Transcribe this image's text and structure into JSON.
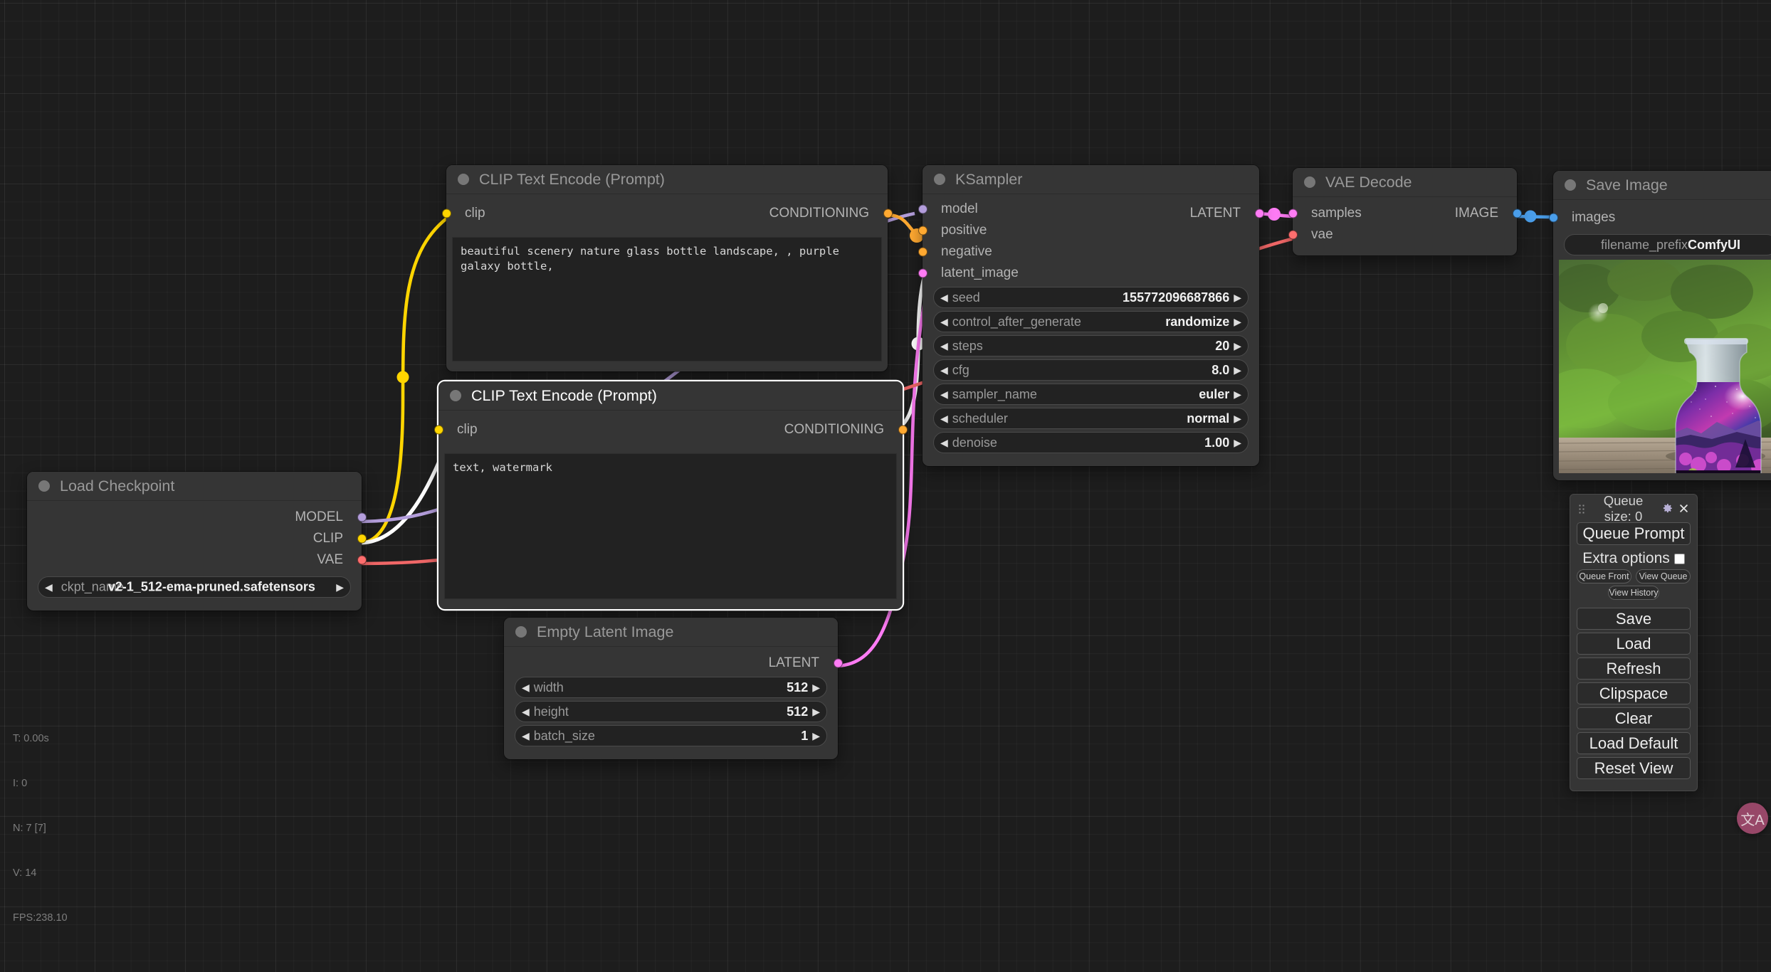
{
  "app": {
    "name": "ComfyUI"
  },
  "colors": {
    "canvas_bg": "#1d1d1d",
    "node_bg": "#353535",
    "node_body": "#353535",
    "widget_bg": "#222222",
    "slot_model": "#b39ddb",
    "slot_clip": "#ffd500",
    "slot_vae": "#ff6e6e",
    "slot_conditioning": "#ffa931",
    "slot_latent": "#ff7cf5",
    "slot_image": "#64b5f6",
    "selection": "#ffffff",
    "link_highlight": "#ffffff",
    "fab": "#a14b6e"
  },
  "nodes": [
    {
      "id": "clip_text_encode_positive",
      "title": "CLIP Text Encode (Prompt)",
      "selected": false,
      "inputs": [
        {
          "name": "clip",
          "type": "CLIP",
          "color": "#ffd500"
        }
      ],
      "outputs": [
        {
          "name": "CONDITIONING",
          "type": "CONDITIONING",
          "color": "#ffa931"
        }
      ],
      "text_value": "beautiful scenery nature glass bottle landscape, , purple galaxy bottle,"
    },
    {
      "id": "clip_text_encode_negative",
      "title": "CLIP Text Encode (Prompt)",
      "selected": true,
      "inputs": [
        {
          "name": "clip",
          "type": "CLIP",
          "color": "#ffd500"
        }
      ],
      "outputs": [
        {
          "name": "CONDITIONING",
          "type": "CONDITIONING",
          "color": "#ffa931"
        }
      ],
      "text_value": "text, watermark"
    },
    {
      "id": "ksampler",
      "title": "KSampler",
      "selected": false,
      "inputs": [
        {
          "name": "model",
          "type": "MODEL",
          "color": "#b39ddb"
        },
        {
          "name": "positive",
          "type": "CONDITIONING",
          "color": "#ffa931"
        },
        {
          "name": "negative",
          "type": "CONDITIONING",
          "color": "#ffa931"
        },
        {
          "name": "latent_image",
          "type": "LATENT",
          "color": "#ff7cf5"
        }
      ],
      "outputs": [
        {
          "name": "LATENT",
          "type": "LATENT",
          "color": "#ff7cf5"
        }
      ],
      "widgets": [
        {
          "name": "seed",
          "value": "155772096687866"
        },
        {
          "name": "control_after_generate",
          "value": "randomize"
        },
        {
          "name": "steps",
          "value": "20"
        },
        {
          "name": "cfg",
          "value": "8.0"
        },
        {
          "name": "sampler_name",
          "value": "euler"
        },
        {
          "name": "scheduler",
          "value": "normal"
        },
        {
          "name": "denoise",
          "value": "1.00"
        }
      ]
    },
    {
      "id": "vae_decode",
      "title": "VAE Decode",
      "selected": false,
      "inputs": [
        {
          "name": "samples",
          "type": "LATENT",
          "color": "#ff7cf5"
        },
        {
          "name": "vae",
          "type": "VAE",
          "color": "#ff6e6e"
        }
      ],
      "outputs": [
        {
          "name": "IMAGE",
          "type": "IMAGE",
          "color": "#64b5f6"
        }
      ]
    },
    {
      "id": "save_image",
      "title": "Save Image",
      "selected": false,
      "inputs": [
        {
          "name": "images",
          "type": "IMAGE",
          "color": "#64b5f6"
        }
      ],
      "widgets": [
        {
          "name": "filename_prefix",
          "value": "ComfyUI"
        }
      ],
      "preview_alt": "purple galaxy bottle on wooden table with blurred green foliage"
    },
    {
      "id": "load_checkpoint",
      "title": "Load Checkpoint",
      "selected": false,
      "outputs": [
        {
          "name": "MODEL",
          "type": "MODEL",
          "color": "#b39ddb"
        },
        {
          "name": "CLIP",
          "type": "CLIP",
          "color": "#ffd500"
        },
        {
          "name": "VAE",
          "type": "VAE",
          "color": "#ff6e6e"
        }
      ],
      "widgets": [
        {
          "name": "ckpt_name",
          "value": "v2-1_512-ema-pruned.safetensors"
        }
      ]
    },
    {
      "id": "empty_latent_image",
      "title": "Empty Latent Image",
      "selected": false,
      "outputs": [
        {
          "name": "LATENT",
          "type": "LATENT",
          "color": "#ff7cf5"
        }
      ],
      "widgets": [
        {
          "name": "width",
          "value": "512"
        },
        {
          "name": "height",
          "value": "512"
        },
        {
          "name": "batch_size",
          "value": "1"
        }
      ]
    }
  ],
  "menu": {
    "queue_size_label": "Queue size: 0",
    "gear_icon": "gear-icon",
    "close_icon": "close-icon",
    "queue_prompt": "Queue Prompt",
    "extra_options": "Extra options",
    "extra_options_checked": true,
    "queue_front": "Queue Front",
    "view_queue": "View Queue",
    "view_history": "View History",
    "save": "Save",
    "load": "Load",
    "refresh": "Refresh",
    "clipspace": "Clipspace",
    "clear": "Clear",
    "load_default": "Load Default",
    "reset_view": "Reset View"
  },
  "fab": {
    "icon": "translate-icon",
    "label": "文A"
  },
  "stats": {
    "time": "T: 0.00s",
    "iterations": "I: 0",
    "nodes": "N: 7 [7]",
    "version": "V: 14",
    "fps": "FPS:238.10"
  }
}
